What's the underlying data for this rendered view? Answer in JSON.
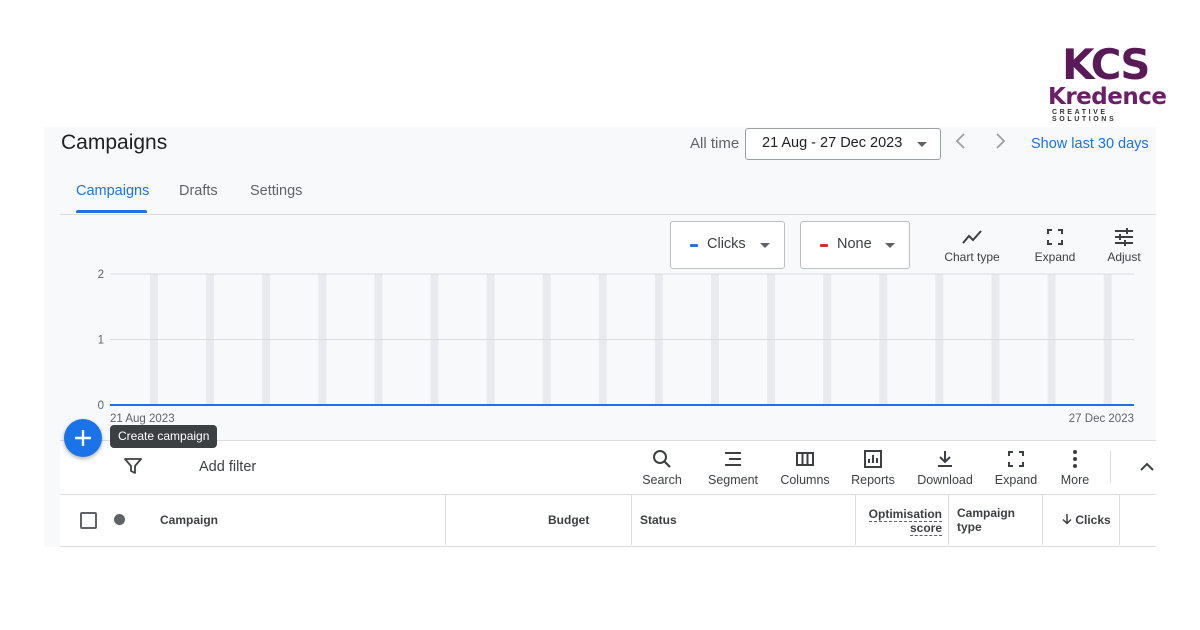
{
  "logo": {
    "mark": "KCS",
    "name": "Kredence",
    "tagline": "CREATIVE SOLUTIONS"
  },
  "header": {
    "title": "Campaigns",
    "range_label": "All time",
    "date_range": "21 Aug - 27 Dec 2023",
    "show_last": "Show last 30 days"
  },
  "tabs": [
    {
      "label": "Campaigns",
      "active": true
    },
    {
      "label": "Drafts",
      "active": false
    },
    {
      "label": "Settings",
      "active": false
    }
  ],
  "metrics": [
    {
      "label": "Clicks",
      "color": "#1a73e8"
    },
    {
      "label": "None",
      "color": "#d93025"
    }
  ],
  "chart_tools": [
    {
      "label": "Chart type",
      "icon": "line-chart-icon"
    },
    {
      "label": "Expand",
      "icon": "expand-icon"
    },
    {
      "label": "Adjust",
      "icon": "sliders-icon"
    }
  ],
  "chart_data": {
    "type": "line",
    "series": [
      {
        "name": "Clicks",
        "values": [
          0,
          0
        ]
      }
    ],
    "x": [
      "21 Aug 2023",
      "27 Dec 2023"
    ],
    "y_ticks": [
      "2",
      "1",
      "0"
    ],
    "ylim": [
      0,
      2
    ],
    "grid": true,
    "line_color": "#1a73e8"
  },
  "fab": {
    "tooltip": "Create campaign"
  },
  "toolbar": {
    "add_filter": "Add filter",
    "buttons": [
      {
        "label": "Search",
        "icon": "search-icon"
      },
      {
        "label": "Segment",
        "icon": "segment-icon"
      },
      {
        "label": "Columns",
        "icon": "columns-icon"
      },
      {
        "label": "Reports",
        "icon": "reports-icon"
      },
      {
        "label": "Download",
        "icon": "download-icon"
      },
      {
        "label": "Expand",
        "icon": "expand-icon"
      },
      {
        "label": "More",
        "icon": "more-vert-icon"
      }
    ]
  },
  "table": {
    "columns": {
      "campaign": "Campaign",
      "budget": "Budget",
      "status": "Status",
      "optimisation_1": "Optimisation",
      "optimisation_2": "score",
      "type_1": "Campaign",
      "type_2": "type",
      "clicks": "Clicks"
    }
  }
}
